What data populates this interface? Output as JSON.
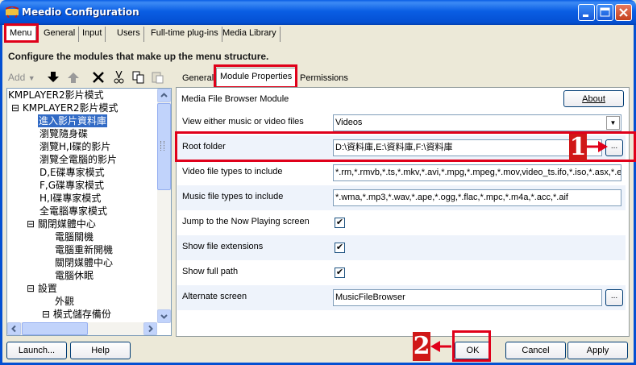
{
  "window": {
    "title": "Meedio Configuration",
    "icon": "meedio-app-icon",
    "controls": [
      "minimize-icon",
      "maximize-icon",
      "close-icon"
    ]
  },
  "top_tabs": [
    "Menu",
    "General",
    "Input",
    "Users",
    "Full-time plug-ins",
    "Media Library"
  ],
  "instruction": "Configure the modules that make up the menu structure.",
  "toolbar": {
    "add_label": "Add",
    "icons": [
      "add-dropdown-icon",
      "move-down-icon",
      "move-up-icon",
      "delete-icon",
      "cut-icon",
      "copy-icon",
      "paste-icon"
    ]
  },
  "tree": {
    "items": [
      "KMPLAYER2影片模式",
      "KMPLAYER2影片模式",
      "進入影片資料庫",
      "瀏覽隨身碟",
      "瀏覽H,I碟的影片",
      "瀏覽全電腦的影片",
      "D,E碟專家模式",
      "F,G碟專家模式",
      "H,I碟專家模式",
      "全電腦專家模式",
      "關閉媒體中心",
      "電腦關機",
      "電腦重新開機",
      "關閉媒體中心",
      "電腦休眠",
      "設置",
      "外觀",
      "模式儲存備份"
    ],
    "selected": "進入影片資料庫"
  },
  "sub_tabs": [
    "General",
    "Module Properties",
    "Permissions"
  ],
  "module": {
    "name": "Media File Browser Module",
    "about_label": "About"
  },
  "properties": [
    {
      "label": "View either music or video files",
      "value": "Videos"
    },
    {
      "label": "Root folder",
      "value": "D:\\資料庫,E:\\資料庫,F:\\資料庫"
    },
    {
      "label": "Video file types to include",
      "value": "*.rm,*.rmvb,*.ts,*.mkv,*.avi,*.mpg,*.mpeg,*.mov,video_ts.ifo,*.iso,*.asx,*.evo"
    },
    {
      "label": "Music file types to include",
      "value": "*.wma,*.mp3,*.wav,*.ape,*.ogg,*.flac,*.mpc,*.m4a,*.acc,*.aif"
    },
    {
      "label": "Jump to the Now Playing screen",
      "value": "✔"
    },
    {
      "label": "Show file extensions",
      "value": "✔"
    },
    {
      "label": "Show full path",
      "value": "✔"
    },
    {
      "label": "Alternate screen",
      "value": "MusicFileBrowser"
    }
  ],
  "browse_label": "...",
  "annotations": {
    "step1": "1",
    "step2": "2"
  },
  "bottom_buttons": {
    "launch": "Launch...",
    "help": "Help",
    "ok": "OK",
    "cancel": "Cancel",
    "apply": "Apply"
  },
  "colors": {
    "title_bar": "#0a5ee4",
    "highlight": "#e0001a",
    "selection": "#316ac5"
  }
}
